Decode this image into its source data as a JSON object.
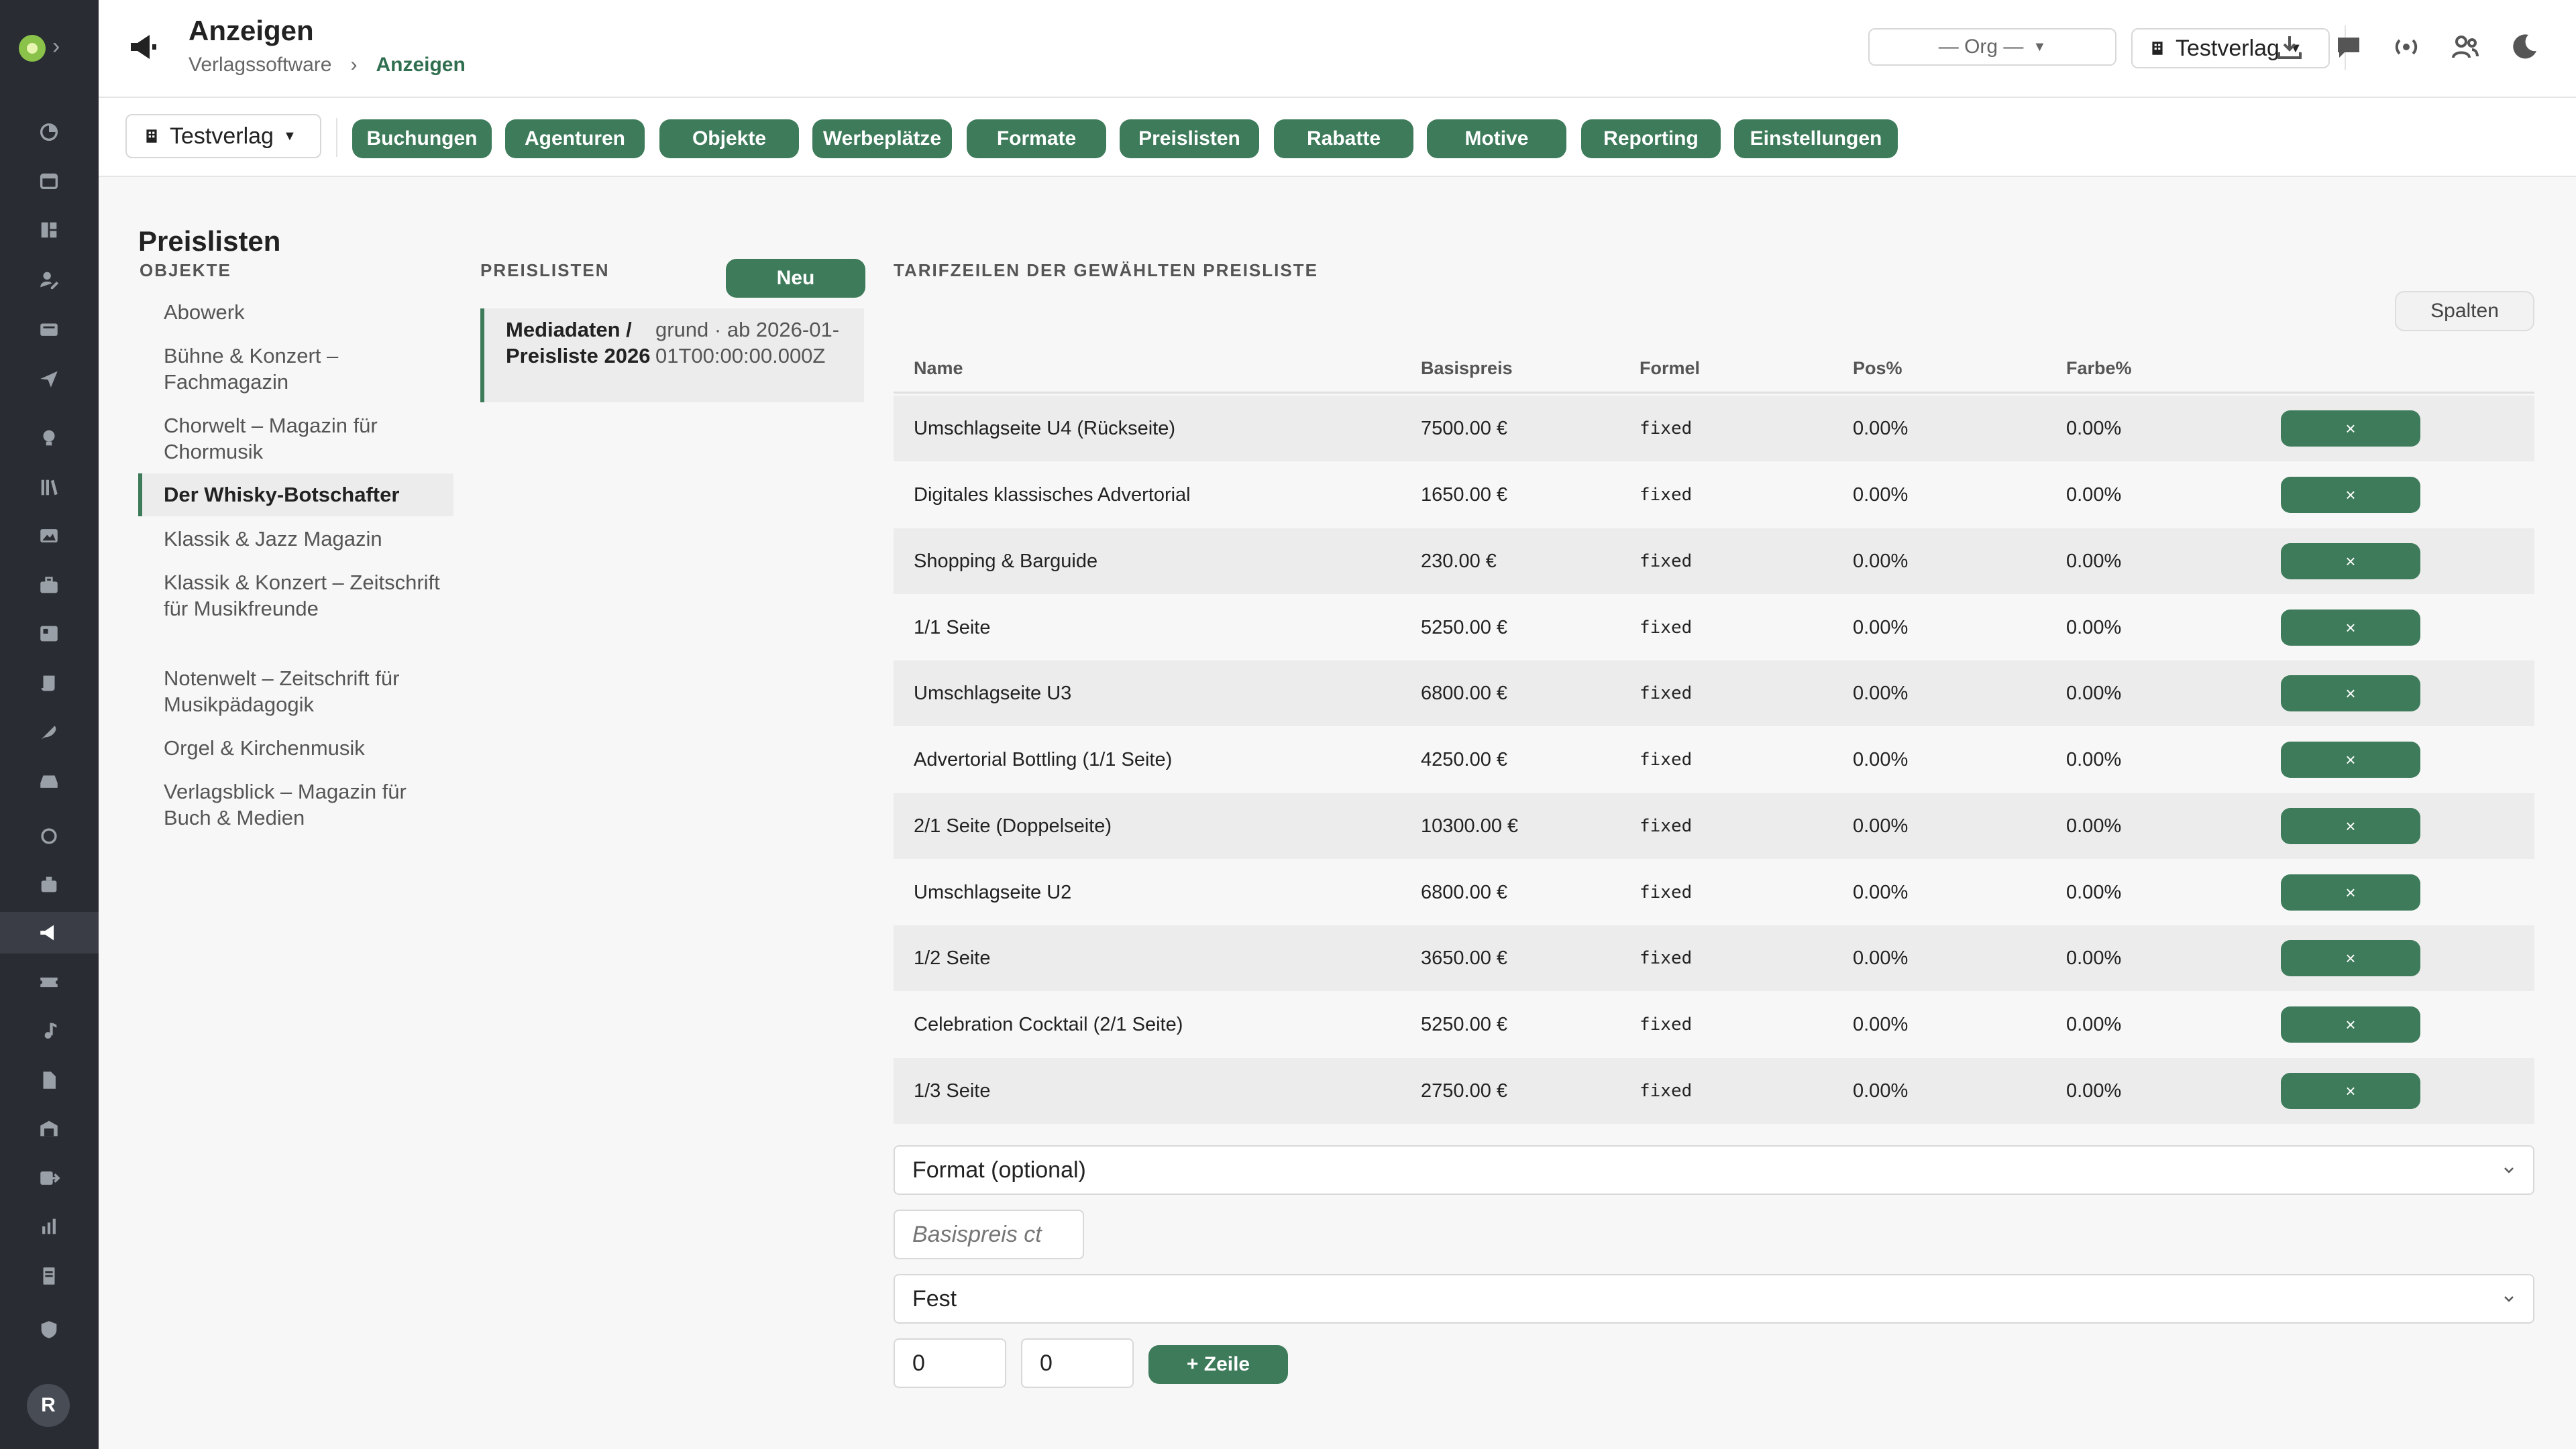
{
  "header": {
    "title": "Anzeigen",
    "breadcrumb": [
      "Verlagssoftware",
      "Anzeigen"
    ],
    "org_select": "— Org —",
    "publisher_select": "Testverlag"
  },
  "subnav": {
    "publisher_select": "Testverlag",
    "tabs": [
      "Buchungen",
      "Agenturen",
      "Objekte",
      "Werbeplätze",
      "Formate",
      "Preislisten",
      "Rabatte",
      "Motive",
      "Reporting",
      "Einstellungen"
    ]
  },
  "objects": {
    "section_title": "Preislisten",
    "label": "OBJEKTE",
    "items": [
      "Abowerk",
      "Bühne & Konzert – Fachmagazin",
      "Chorwelt – Magazin für Chormusik",
      "Der Whisky-Botschafter",
      "Klassik & Jazz Magazin",
      "Klassik & Konzert – Zeitschrift für Musikfreunde",
      "Notenwelt – Zeitschrift für Musikpädagogik",
      "Orgel & Kirchenmusik",
      "Verlagsblick – Magazin für Buch & Medien"
    ],
    "active_index": 3
  },
  "pricelists": {
    "label": "PREISLISTEN",
    "new_button": "Neu",
    "items": [
      {
        "name": "Mediadaten / Preisliste 2026",
        "meta": "grund · ab 2026-01-01T00:00:00.000Z"
      }
    ]
  },
  "tariff": {
    "label": "TARIFZEILEN DER GEWÄHLTEN PREISLISTE",
    "columns_button": "Spalten",
    "headers": [
      "Name",
      "Basispreis",
      "Formel",
      "Pos%",
      "Farbe%"
    ],
    "delete_label": "×",
    "rows": [
      {
        "name": "Umschlagseite U4 (Rückseite)",
        "price": "7500.00 €",
        "formula": "fixed",
        "pos": "0.00%",
        "color": "0.00%"
      },
      {
        "name": "Digitales klassisches Advertorial",
        "price": "1650.00 €",
        "formula": "fixed",
        "pos": "0.00%",
        "color": "0.00%"
      },
      {
        "name": "Shopping & Barguide",
        "price": "230.00 €",
        "formula": "fixed",
        "pos": "0.00%",
        "color": "0.00%"
      },
      {
        "name": "1/1 Seite",
        "price": "5250.00 €",
        "formula": "fixed",
        "pos": "0.00%",
        "color": "0.00%"
      },
      {
        "name": "Umschlagseite U3",
        "price": "6800.00 €",
        "formula": "fixed",
        "pos": "0.00%",
        "color": "0.00%"
      },
      {
        "name": "Advertorial Bottling (1/1 Seite)",
        "price": "4250.00 €",
        "formula": "fixed",
        "pos": "0.00%",
        "color": "0.00%"
      },
      {
        "name": "2/1 Seite (Doppelseite)",
        "price": "10300.00 €",
        "formula": "fixed",
        "pos": "0.00%",
        "color": "0.00%"
      },
      {
        "name": "Umschlagseite U2",
        "price": "6800.00 €",
        "formula": "fixed",
        "pos": "0.00%",
        "color": "0.00%"
      },
      {
        "name": "1/2 Seite",
        "price": "3650.00 €",
        "formula": "fixed",
        "pos": "0.00%",
        "color": "0.00%"
      },
      {
        "name": "Celebration Cocktail (2/1 Seite)",
        "price": "5250.00 €",
        "formula": "fixed",
        "pos": "0.00%",
        "color": "0.00%"
      },
      {
        "name": "1/3 Seite",
        "price": "2750.00 €",
        "formula": "fixed",
        "pos": "0.00%",
        "color": "0.00%"
      }
    ]
  },
  "form": {
    "format_select": "Format (optional)",
    "base_price_placeholder": "Basispreis ct",
    "formula_select": "Fest",
    "pos_value": "0",
    "color_value": "0",
    "add_button": "+ Zeile"
  },
  "user": {
    "initial": "R"
  },
  "colors": {
    "accent": "#3d7b5a",
    "rail": "#2a2c33"
  }
}
